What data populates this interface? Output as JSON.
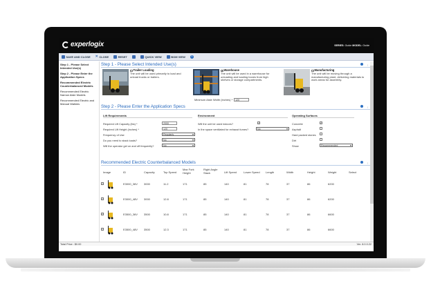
{
  "header": {
    "logo_text": "experlogix",
    "series_label": "SERIES:",
    "series_value": "Guide",
    "model_label": "MODEL:",
    "model_value": "Guide"
  },
  "toolbar": {
    "save_close": "SAVE AND CLOSE",
    "close": "CLOSE",
    "reset": "RESET",
    "quick_view": "QUICK VIEW",
    "bom_view": "BOM VIEW"
  },
  "sidebar": {
    "items": [
      "Step 1 - Please Select Intended Use(s)",
      "Step 2 - Please Enter the Application Specs",
      "Recommended Electric Counterbalanced Models",
      "Recommended Electric Narrow Aisle Models",
      "Recommended Electric and Manual Walkies"
    ]
  },
  "step1": {
    "title": "Step 1 - Please Select Intended Use(s)",
    "uses": [
      {
        "name": "Trailer Loading",
        "desc": "The unit will be used primarily to load and unload trucks or trailers.",
        "checked": false
      },
      {
        "name": "Warehouse",
        "desc": "The unit will be used in a warehouse for unloading and loading boxes from high shelves or storage compartments.",
        "checked": true
      },
      {
        "name": "Manufacturing",
        "desc": "The unit will be moving through a manufacturing plant, delivering materials to work areas for assembly.",
        "checked": false
      }
    ],
    "min_aisle_label": "Minimum Aisle Width (inches) *",
    "min_aisle_value": "120"
  },
  "step2": {
    "title": "Step 2 - Please Enter the Application Specs",
    "lift_header": "Lift Requirements",
    "env_header": "Environment",
    "surface_header": "Operating Surfaces",
    "capacity_label": "Required Lift Capacity (lbs) *",
    "capacity_value": "2000",
    "height_label": "Required Lift Height (inches) *",
    "height_value": "120",
    "frequency_label": "Frequency of Use",
    "frequency_value": "Regularly",
    "stack_label": "Do you need to stack loads?",
    "stack_value": "No",
    "onoff_label": "Will the operator get on and off frequently?",
    "onoff_value": "No",
    "indoors_label": "Will the unit be used indoors?",
    "ventilated_label": "In the space ventilated for exhaust fumes?",
    "ventilated_value": "No",
    "surfaces": [
      "Concrete",
      "Asphalt",
      "Hard packed stones",
      "Dirt"
    ],
    "show_label": "Show",
    "show_value": "Recommended"
  },
  "models": {
    "title": "Recommended Electric Counterbalanced Models",
    "columns": [
      "Image",
      "ID",
      "Capacity",
      "Top Speed",
      "Max Fork Height",
      "Right Angle Stack",
      "Lift Speed",
      "Lower Speed",
      "Length",
      "Width",
      "Height",
      "Weight",
      "Select"
    ],
    "rows": [
      [
        "E3000_36V",
        "3000",
        "11.2",
        "171",
        "85",
        "140",
        "81",
        "78",
        "37",
        "86",
        "6200"
      ],
      [
        "E3000_48V",
        "3000",
        "12.8",
        "171",
        "85",
        "140",
        "81",
        "78",
        "37",
        "86",
        "6200"
      ],
      [
        "E3500_36V",
        "3500",
        "10.8",
        "171",
        "85",
        "140",
        "81",
        "78",
        "37",
        "86",
        "6600"
      ],
      [
        "E3500_48V",
        "3500",
        "12.3",
        "171",
        "85",
        "140",
        "81",
        "78",
        "37",
        "86",
        "6600"
      ]
    ]
  },
  "footer": {
    "total_label": "Total Price :",
    "total_value": "$0.00",
    "version": "Ver. 8.0.0.22"
  }
}
